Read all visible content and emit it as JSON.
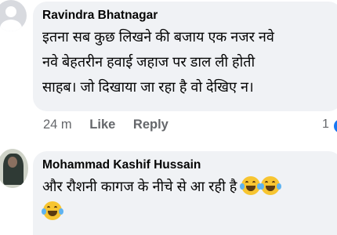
{
  "comments": [
    {
      "author": "Ravindra Bhatnagar",
      "text_lines": [
        "इतना सब कुछ लिखने की बजाय एक नजर नवे",
        "नवे बेहतरीन हवाई जहाज पर डाल ली होती",
        "साहब। जो दिखाया जा रहा है वो देखिए न।"
      ],
      "time": "24 m",
      "like_label": "Like",
      "reply_label": "Reply",
      "reaction_count": "1",
      "reaction_icon": "like-reaction-icon"
    },
    {
      "author": "Mohammad Kashif Hussain",
      "text": "और रौशनी कागज के नीचे से आ रही है",
      "emoji_icon": "face-with-tears-of-joy-icon"
    }
  ]
}
